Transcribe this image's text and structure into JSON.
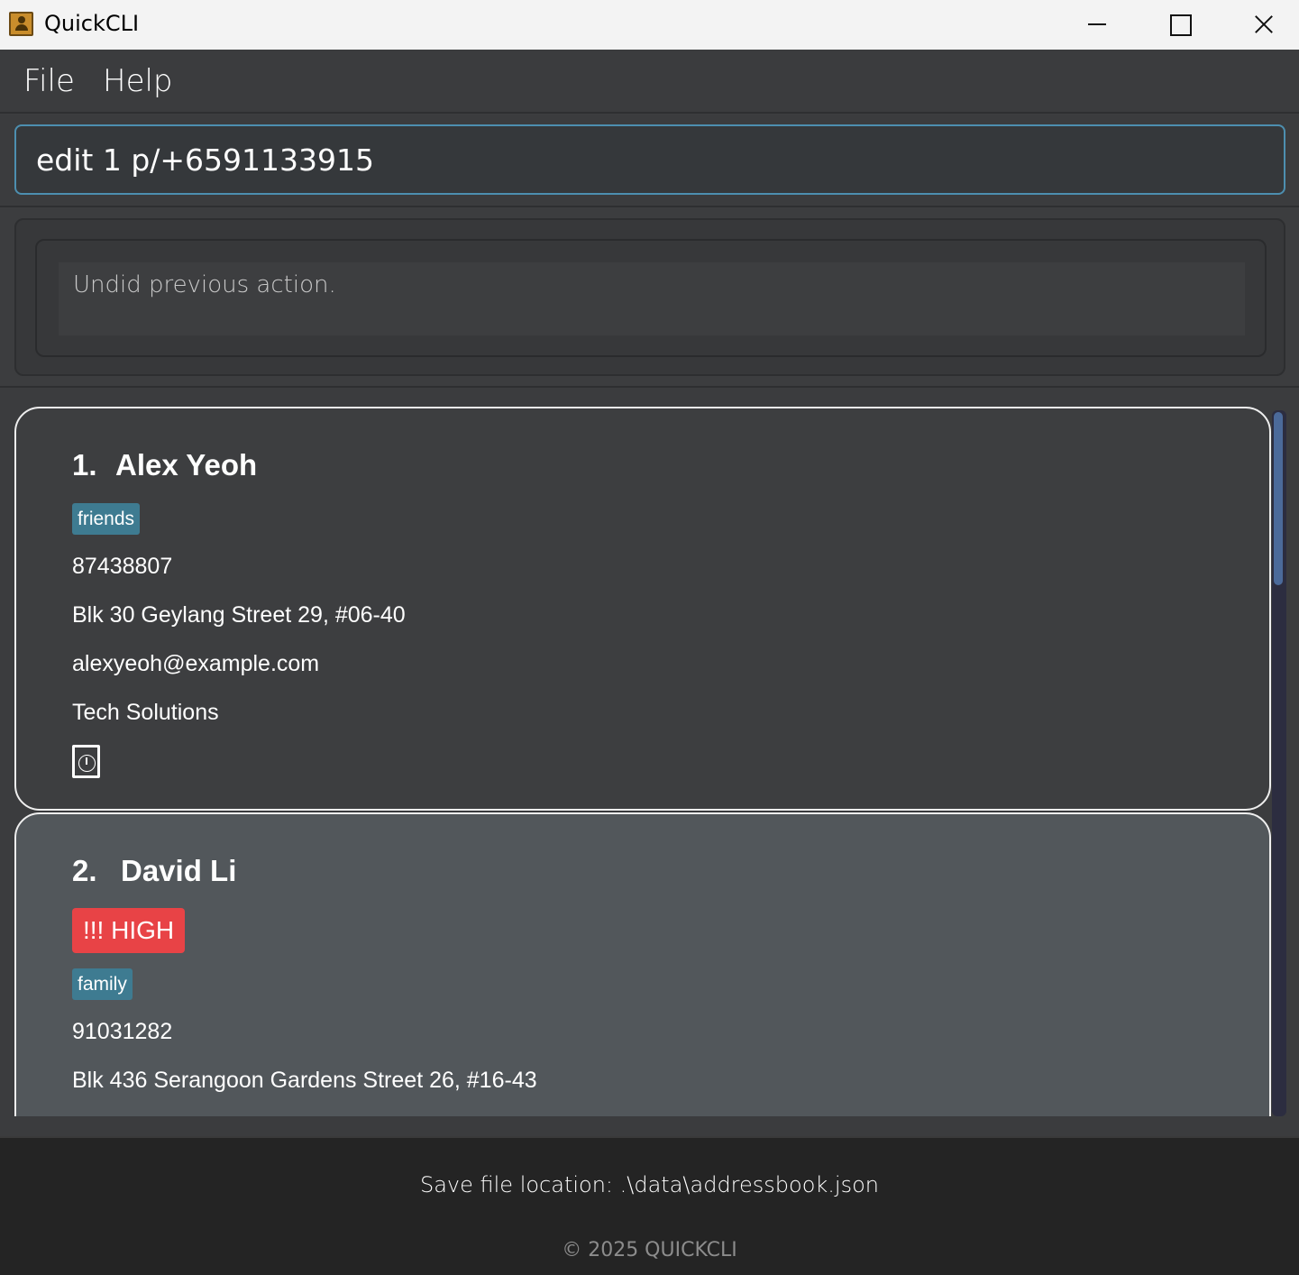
{
  "window": {
    "title": "QuickCLI"
  },
  "menu": {
    "file": "File",
    "help": "Help"
  },
  "command": {
    "value": "edit 1 p/+6591133915"
  },
  "result": {
    "message": "Undid previous action."
  },
  "persons": [
    {
      "index": "1.",
      "name": "Alex Yeoh",
      "tags": [
        "friends"
      ],
      "phone": "87438807",
      "address": "Blk 30 Geylang Street 29, #06-40",
      "email": "alexyeoh@example.com",
      "company": "Tech Solutions",
      "icon": "timer-icon"
    },
    {
      "index": "2.",
      "name": "David Li",
      "priority": "!!! HIGH",
      "tags": [
        "family"
      ],
      "phone": "91031282",
      "address": "Blk 436 Serangoon Gardens Street 26, #16-43"
    }
  ],
  "status": {
    "save_location": "Save file location: .\\data\\addressbook.json",
    "copyright": "© 2025 QUICKCLI"
  },
  "colors": {
    "tag": "#3e7b91",
    "priority_high": "#e84346",
    "input_border": "#4d8fb0"
  }
}
